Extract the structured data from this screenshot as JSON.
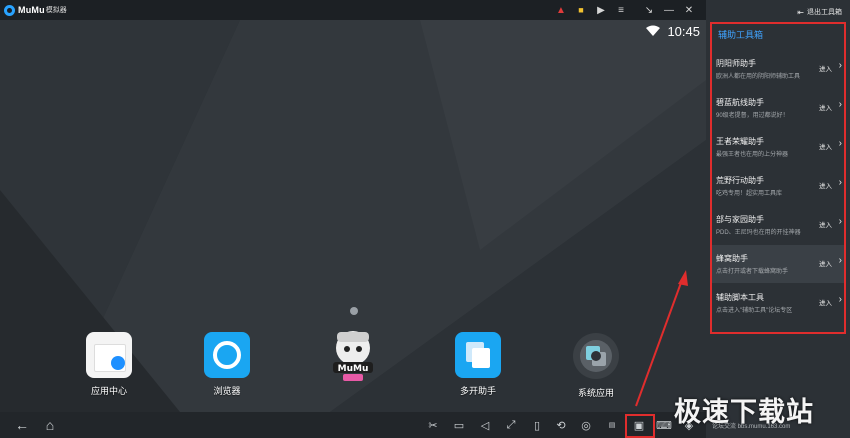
{
  "window": {
    "logo_text": "MuMu",
    "logo_sub": "模拟器",
    "titlebar_icons": [
      "warning-icon",
      "gift-icon",
      "play-icon",
      "menu-icon",
      "collapse-icon",
      "minimize-icon",
      "close-icon"
    ]
  },
  "android": {
    "clock": "10:45",
    "apps": [
      {
        "label": "应用中心",
        "icon": "app-center-icon"
      },
      {
        "label": "浏览器",
        "icon": "browser-icon"
      },
      {
        "label": "",
        "icon": "mumu-mascot-icon"
      },
      {
        "label": "多开助手",
        "icon": "multi-instance-icon"
      },
      {
        "label": "系统应用",
        "icon": "system-apps-icon"
      }
    ],
    "nav": [
      "back-icon",
      "home-icon"
    ],
    "toolbar_icons": [
      "cut-icon",
      "folder-icon",
      "volume-icon",
      "fullscreen-icon",
      "shake-icon",
      "rotate-icon",
      "location-icon",
      "apk-icon",
      "toolbox-icon",
      "keyboard-icon",
      "gamepad-icon"
    ]
  },
  "panel": {
    "exit_label": "退出工具箱",
    "title": "辅助工具箱",
    "enter_label": "进入",
    "tools": [
      {
        "name": "阴阳师助手",
        "desc": "欧洲人都在用的阴阳师辅助工具"
      },
      {
        "name": "碧蓝航线助手",
        "desc": "90级老提督，用过都说好！"
      },
      {
        "name": "王者荣耀助手",
        "desc": "最强王者也在用的上分神器"
      },
      {
        "name": "荒野行动助手",
        "desc": "吃鸡专用！超实用工具库"
      },
      {
        "name": "部与家园助手",
        "desc": "PDD、王尼玛也在用的开挂神器"
      },
      {
        "name": "蜂窝助手",
        "desc": "点击打开或者下载蜂窝助手"
      },
      {
        "name": "辅助脚本工具",
        "desc": "点击进入\"辅助工具\"论坛专区"
      }
    ]
  },
  "watermark": {
    "text": "极速下载站",
    "sub": "论坛交流 bbs.mumu.163.com"
  },
  "colors": {
    "accent": "#3fa3ff",
    "highlight": "#e02d2d",
    "panel_bg": "#2c3136"
  }
}
